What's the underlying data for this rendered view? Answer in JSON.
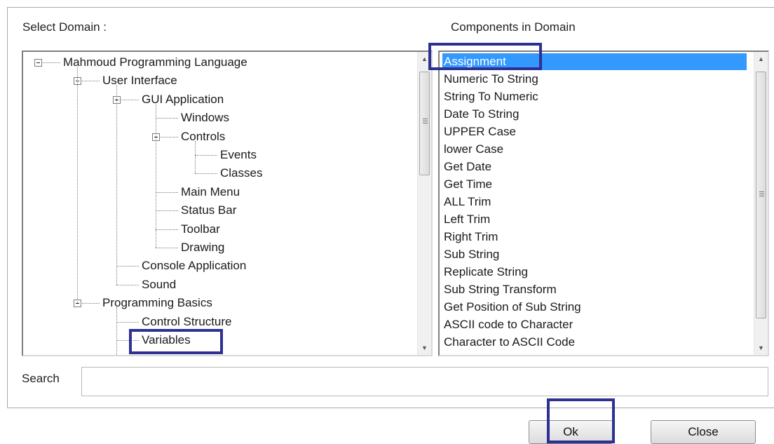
{
  "dialog": {
    "select_domain_label": "Select Domain :",
    "components_label": "Components in Domain",
    "search_label": "Search",
    "search_value": "",
    "ok_label": "Ok",
    "close_label": "Close",
    "highlight_color": "#2e3192",
    "selection_color": "#3399ff"
  },
  "tree": {
    "nodes": [
      {
        "label": "Mahmoud Programming Language",
        "level": 0,
        "expanded": true
      },
      {
        "label": "User Interface",
        "level": 1,
        "expanded": true
      },
      {
        "label": "GUI Application",
        "level": 2,
        "expanded": true
      },
      {
        "label": "Windows",
        "level": 3
      },
      {
        "label": "Controls",
        "level": 3,
        "expanded": true
      },
      {
        "label": "Events",
        "level": 4
      },
      {
        "label": "Classes",
        "level": 4
      },
      {
        "label": "Main Menu",
        "level": 3
      },
      {
        "label": "Status Bar",
        "level": 3
      },
      {
        "label": "Toolbar",
        "level": 3
      },
      {
        "label": "Drawing",
        "level": 3
      },
      {
        "label": "Console Application",
        "level": 2
      },
      {
        "label": "Sound",
        "level": 2
      },
      {
        "label": "Programming Basics",
        "level": 1,
        "expanded": true
      },
      {
        "label": "Control Structure",
        "level": 2
      },
      {
        "label": "Variables",
        "level": 2
      }
    ]
  },
  "components": {
    "selected_index": 0,
    "items": [
      "Assignment",
      "Numeric To String",
      "String To Numeric",
      "Date To String",
      "UPPER Case",
      "lower Case",
      "Get Date",
      "Get Time",
      "ALL Trim",
      "Left Trim",
      "Right Trim",
      "Sub String",
      "Replicate String",
      "Sub String Transform",
      "Get Position of Sub String",
      "ASCII code to Character",
      "Character to ASCII Code"
    ]
  }
}
